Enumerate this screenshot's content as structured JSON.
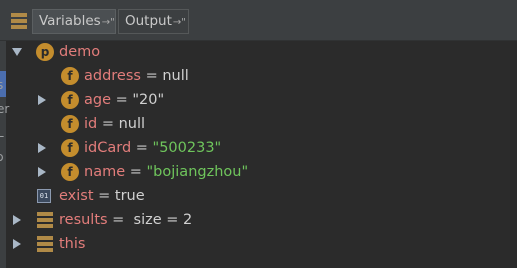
{
  "tabs": [
    {
      "label": "Variables",
      "pin": "→\"",
      "active": true
    },
    {
      "label": "Output",
      "pin": "→\"",
      "active": false
    }
  ],
  "gutter": {
    "chars": [
      "s",
      "er",
      "L",
      "ɔ"
    ]
  },
  "tree": {
    "root": {
      "badge": "p",
      "name": "demo"
    },
    "fields": [
      {
        "badge": "f",
        "name": "address",
        "op": " = ",
        "value": "null",
        "value_type": "plain",
        "expandable": false
      },
      {
        "badge": "f",
        "name": "age",
        "op": " = ",
        "value": "\"20\"",
        "value_type": "plain",
        "expandable": true
      },
      {
        "badge": "f",
        "name": "id",
        "op": " = ",
        "value": "null",
        "value_type": "plain",
        "expandable": false
      },
      {
        "badge": "f",
        "name": "idCard",
        "op": " = ",
        "value": "\"500233\"",
        "value_type": "string",
        "expandable": true
      },
      {
        "badge": "f",
        "name": "name",
        "op": " = ",
        "value": "\"bojiangzhou\"",
        "value_type": "string",
        "expandable": true
      }
    ],
    "exist": {
      "icon_text": "01",
      "name": "exist",
      "op": " = ",
      "value": "true"
    },
    "results": {
      "name": "results",
      "op": " = ",
      "value": " size = 2"
    },
    "this": {
      "name": "this"
    }
  },
  "colors": {
    "background": "#2b2b2b",
    "name": "#e27d7b",
    "string": "#6fc55c",
    "badge": "#c48d2d"
  },
  "icons": {
    "tab_icon": "variables-stack-icon",
    "badge_icon": "field-badge-icon",
    "bool_icon": "primitive-boolean-icon",
    "stack_icon": "object-stack-icon"
  }
}
